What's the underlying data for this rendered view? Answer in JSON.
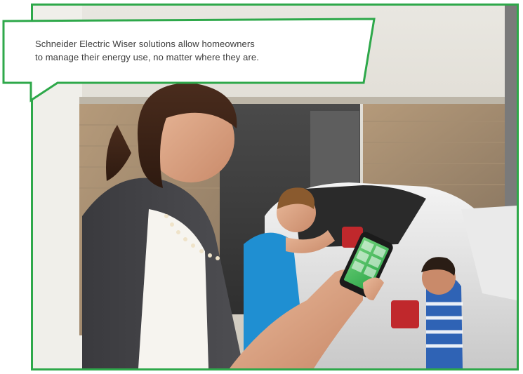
{
  "callout": {
    "line1": "Schneider Electric Wiser solutions allow homeowners",
    "line2": "to manage their energy use, no matter where they are."
  },
  "colors": {
    "frame": "#2ea84a",
    "callout_fill": "#ffffff",
    "callout_text": "#3c3c3c"
  },
  "photo": {
    "icon": "family-with-car-photo"
  }
}
